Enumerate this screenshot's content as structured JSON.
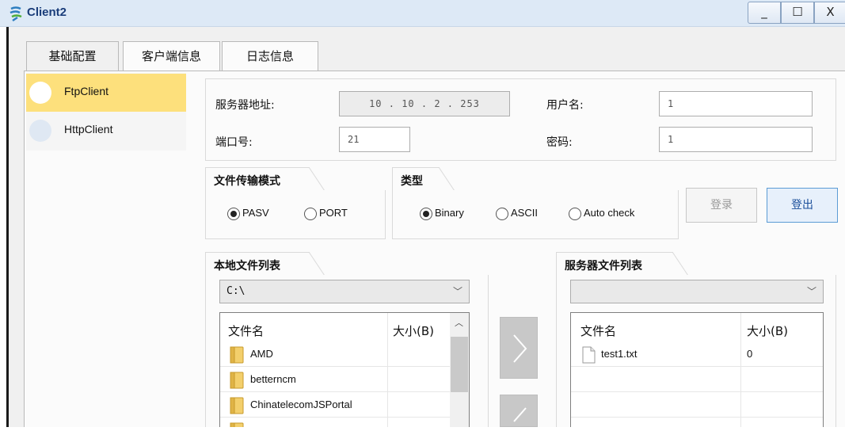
{
  "window": {
    "title": "Client2",
    "minimize_glyph": "_",
    "maximize_glyph": "☐",
    "close_glyph": "X"
  },
  "tabs": [
    {
      "label": "基础配置",
      "active": false
    },
    {
      "label": "客户端信息",
      "active": true
    },
    {
      "label": "日志信息",
      "active": false
    }
  ],
  "sidebar": {
    "items": [
      {
        "label": "FtpClient",
        "selected": true
      },
      {
        "label": "HttpClient",
        "selected": false
      }
    ]
  },
  "server": {
    "address_label": "服务器地址:",
    "address_value": "10  .  10  .  2  . 253",
    "port_label": "端口号:",
    "port_value": "21",
    "username_label": "用户名:",
    "username_value": "1",
    "password_label": "密码:",
    "password_value": "1"
  },
  "transfer_mode": {
    "title": "文件传输模式",
    "options": [
      {
        "label": "PASV",
        "checked": true
      },
      {
        "label": "PORT",
        "checked": false
      }
    ]
  },
  "type": {
    "title": "类型",
    "options": [
      {
        "label": "Binary",
        "checked": true
      },
      {
        "label": "ASCII",
        "checked": false
      },
      {
        "label": "Auto check",
        "checked": false
      }
    ]
  },
  "actions": {
    "login_label": "登录",
    "logout_label": "登出"
  },
  "local_files": {
    "title": "本地文件列表",
    "path": "C:\\",
    "col_name": "文件名",
    "col_size": "大小(B)",
    "rows": [
      {
        "name": "AMD",
        "size": ""
      },
      {
        "name": "betterncm",
        "size": ""
      },
      {
        "name": "ChinatelecomJSPortal",
        "size": ""
      }
    ]
  },
  "server_files": {
    "title": "服务器文件列表",
    "path": "",
    "col_name": "文件名",
    "col_size": "大小(B)",
    "rows": [
      {
        "name": "test1.txt",
        "size": "0"
      }
    ]
  },
  "colors": {
    "selected_item": "#fde07c",
    "titlebar": "#dde9f6",
    "accent_border": "#5b9bd5"
  }
}
